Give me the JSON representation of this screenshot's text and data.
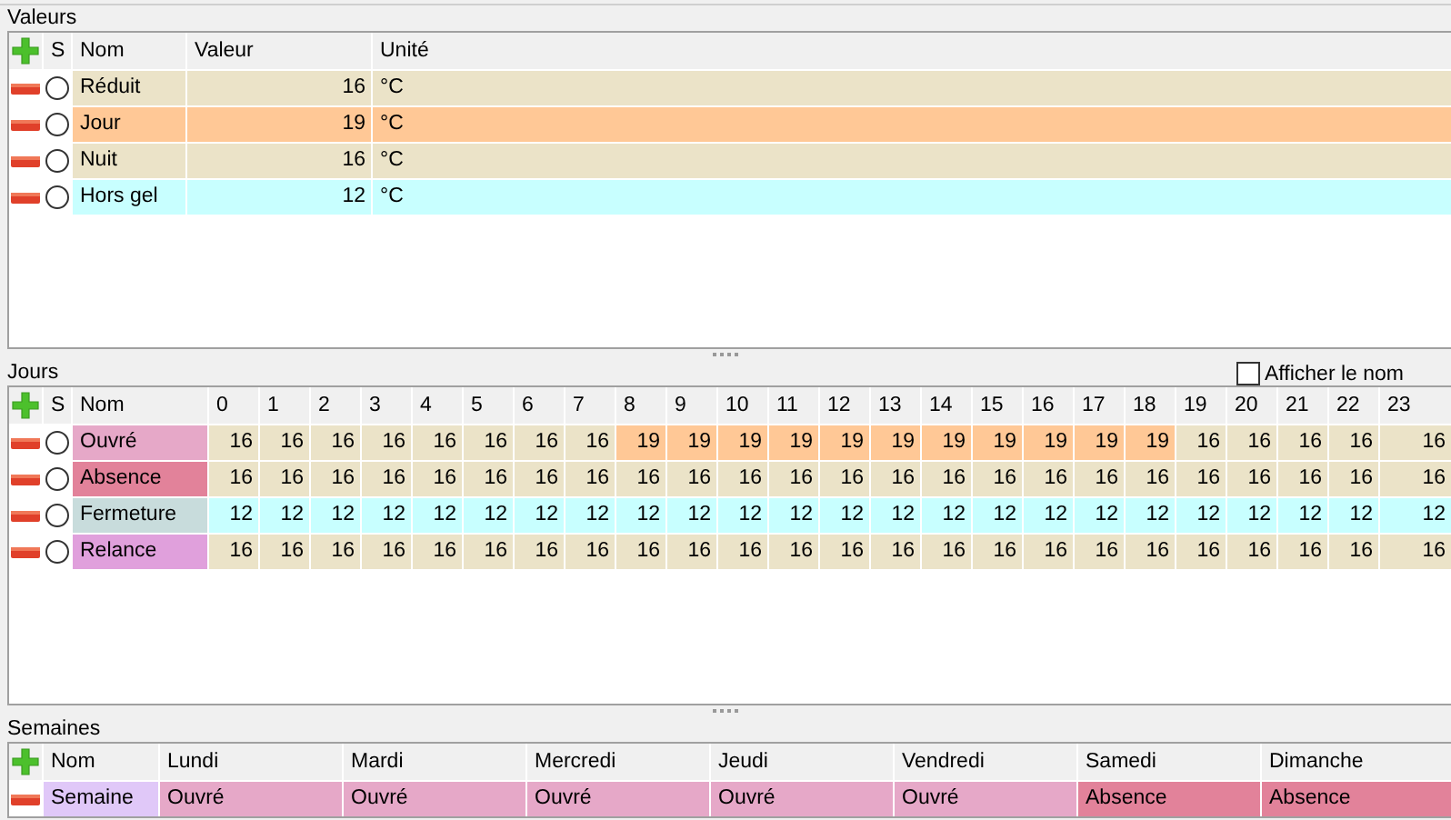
{
  "valeurs": {
    "title": "Valeurs",
    "columns": [
      "S",
      "Nom",
      "Valeur",
      "Unité"
    ],
    "rows": [
      {
        "selected": false,
        "name": "Réduit",
        "value": "16",
        "unit": "°C",
        "color": "#ebe3c8"
      },
      {
        "selected": false,
        "name": "Jour",
        "value": "19",
        "unit": "°C",
        "color": "#ffc896"
      },
      {
        "selected": false,
        "name": "Nuit",
        "value": "16",
        "unit": "°C",
        "color": "#ebe3c8"
      },
      {
        "selected": false,
        "name": "Hors gel",
        "value": "12",
        "unit": "°C",
        "color": "#c8ffff"
      }
    ]
  },
  "jours": {
    "title": "Jours",
    "show_name": {
      "label": "Afficher le nom",
      "checked": false
    },
    "columns": [
      "S",
      "Nom",
      "0",
      "1",
      "2",
      "3",
      "4",
      "5",
      "6",
      "7",
      "8",
      "9",
      "10",
      "11",
      "12",
      "13",
      "14",
      "15",
      "16",
      "17",
      "18",
      "19",
      "20",
      "21",
      "22",
      "23"
    ],
    "rows": [
      {
        "selected": false,
        "name": "Ouvré",
        "color": "#e6a8c8",
        "hours": [
          {
            "value": "16",
            "color": "#ebe3c8"
          },
          {
            "value": "16",
            "color": "#ebe3c8"
          },
          {
            "value": "16",
            "color": "#ebe3c8"
          },
          {
            "value": "16",
            "color": "#ebe3c8"
          },
          {
            "value": "16",
            "color": "#ebe3c8"
          },
          {
            "value": "16",
            "color": "#ebe3c8"
          },
          {
            "value": "16",
            "color": "#ebe3c8"
          },
          {
            "value": "16",
            "color": "#ebe3c8"
          },
          {
            "value": "19",
            "color": "#ffc896"
          },
          {
            "value": "19",
            "color": "#ffc896"
          },
          {
            "value": "19",
            "color": "#ffc896"
          },
          {
            "value": "19",
            "color": "#ffc896"
          },
          {
            "value": "19",
            "color": "#ffc896"
          },
          {
            "value": "19",
            "color": "#ffc896"
          },
          {
            "value": "19",
            "color": "#ffc896"
          },
          {
            "value": "19",
            "color": "#ffc896"
          },
          {
            "value": "19",
            "color": "#ffc896"
          },
          {
            "value": "19",
            "color": "#ffc896"
          },
          {
            "value": "19",
            "color": "#ffc896"
          },
          {
            "value": "16",
            "color": "#ebe3c8"
          },
          {
            "value": "16",
            "color": "#ebe3c8"
          },
          {
            "value": "16",
            "color": "#ebe3c8"
          },
          {
            "value": "16",
            "color": "#ebe3c8"
          },
          {
            "value": "16",
            "color": "#ebe3c8"
          }
        ]
      },
      {
        "selected": false,
        "name": "Absence",
        "color": "#e2829a",
        "hours": [
          {
            "value": "16",
            "color": "#ebe3c8"
          },
          {
            "value": "16",
            "color": "#ebe3c8"
          },
          {
            "value": "16",
            "color": "#ebe3c8"
          },
          {
            "value": "16",
            "color": "#ebe3c8"
          },
          {
            "value": "16",
            "color": "#ebe3c8"
          },
          {
            "value": "16",
            "color": "#ebe3c8"
          },
          {
            "value": "16",
            "color": "#ebe3c8"
          },
          {
            "value": "16",
            "color": "#ebe3c8"
          },
          {
            "value": "16",
            "color": "#ebe3c8"
          },
          {
            "value": "16",
            "color": "#ebe3c8"
          },
          {
            "value": "16",
            "color": "#ebe3c8"
          },
          {
            "value": "16",
            "color": "#ebe3c8"
          },
          {
            "value": "16",
            "color": "#ebe3c8"
          },
          {
            "value": "16",
            "color": "#ebe3c8"
          },
          {
            "value": "16",
            "color": "#ebe3c8"
          },
          {
            "value": "16",
            "color": "#ebe3c8"
          },
          {
            "value": "16",
            "color": "#ebe3c8"
          },
          {
            "value": "16",
            "color": "#ebe3c8"
          },
          {
            "value": "16",
            "color": "#ebe3c8"
          },
          {
            "value": "16",
            "color": "#ebe3c8"
          },
          {
            "value": "16",
            "color": "#ebe3c8"
          },
          {
            "value": "16",
            "color": "#ebe3c8"
          },
          {
            "value": "16",
            "color": "#ebe3c8"
          },
          {
            "value": "16",
            "color": "#ebe3c8"
          }
        ]
      },
      {
        "selected": false,
        "name": "Fermeture",
        "color": "#c8dcdc",
        "hours": [
          {
            "value": "12",
            "color": "#c8ffff"
          },
          {
            "value": "12",
            "color": "#c8ffff"
          },
          {
            "value": "12",
            "color": "#c8ffff"
          },
          {
            "value": "12",
            "color": "#c8ffff"
          },
          {
            "value": "12",
            "color": "#c8ffff"
          },
          {
            "value": "12",
            "color": "#c8ffff"
          },
          {
            "value": "12",
            "color": "#c8ffff"
          },
          {
            "value": "12",
            "color": "#c8ffff"
          },
          {
            "value": "12",
            "color": "#c8ffff"
          },
          {
            "value": "12",
            "color": "#c8ffff"
          },
          {
            "value": "12",
            "color": "#c8ffff"
          },
          {
            "value": "12",
            "color": "#c8ffff"
          },
          {
            "value": "12",
            "color": "#c8ffff"
          },
          {
            "value": "12",
            "color": "#c8ffff"
          },
          {
            "value": "12",
            "color": "#c8ffff"
          },
          {
            "value": "12",
            "color": "#c8ffff"
          },
          {
            "value": "12",
            "color": "#c8ffff"
          },
          {
            "value": "12",
            "color": "#c8ffff"
          },
          {
            "value": "12",
            "color": "#c8ffff"
          },
          {
            "value": "12",
            "color": "#c8ffff"
          },
          {
            "value": "12",
            "color": "#c8ffff"
          },
          {
            "value": "12",
            "color": "#c8ffff"
          },
          {
            "value": "12",
            "color": "#c8ffff"
          },
          {
            "value": "12",
            "color": "#c8ffff"
          }
        ]
      },
      {
        "selected": false,
        "name": "Relance",
        "color": "#e0a0dc",
        "hours": [
          {
            "value": "16",
            "color": "#ebe3c8"
          },
          {
            "value": "16",
            "color": "#ebe3c8"
          },
          {
            "value": "16",
            "color": "#ebe3c8"
          },
          {
            "value": "16",
            "color": "#ebe3c8"
          },
          {
            "value": "16",
            "color": "#ebe3c8"
          },
          {
            "value": "16",
            "color": "#ebe3c8"
          },
          {
            "value": "16",
            "color": "#ebe3c8"
          },
          {
            "value": "16",
            "color": "#ebe3c8"
          },
          {
            "value": "16",
            "color": "#ebe3c8"
          },
          {
            "value": "16",
            "color": "#ebe3c8"
          },
          {
            "value": "16",
            "color": "#ebe3c8"
          },
          {
            "value": "16",
            "color": "#ebe3c8"
          },
          {
            "value": "16",
            "color": "#ebe3c8"
          },
          {
            "value": "16",
            "color": "#ebe3c8"
          },
          {
            "value": "16",
            "color": "#ebe3c8"
          },
          {
            "value": "16",
            "color": "#ebe3c8"
          },
          {
            "value": "16",
            "color": "#ebe3c8"
          },
          {
            "value": "16",
            "color": "#ebe3c8"
          },
          {
            "value": "16",
            "color": "#ebe3c8"
          },
          {
            "value": "16",
            "color": "#ebe3c8"
          },
          {
            "value": "16",
            "color": "#ebe3c8"
          },
          {
            "value": "16",
            "color": "#ebe3c8"
          },
          {
            "value": "16",
            "color": "#ebe3c8"
          },
          {
            "value": "16",
            "color": "#ebe3c8"
          }
        ]
      }
    ]
  },
  "semaines": {
    "title": "Semaines",
    "columns": [
      "Nom",
      "Lundi",
      "Mardi",
      "Mercredi",
      "Jeudi",
      "Vendredi",
      "Samedi",
      "Dimanche"
    ],
    "rows": [
      {
        "name": "Semaine",
        "color": "#e0c8f8",
        "days": [
          {
            "value": "Ouvré",
            "color": "#e6a8c8"
          },
          {
            "value": "Ouvré",
            "color": "#e6a8c8"
          },
          {
            "value": "Ouvré",
            "color": "#e6a8c8"
          },
          {
            "value": "Ouvré",
            "color": "#e6a8c8"
          },
          {
            "value": "Ouvré",
            "color": "#e6a8c8"
          },
          {
            "value": "Absence",
            "color": "#e2829a"
          },
          {
            "value": "Absence",
            "color": "#e2829a"
          }
        ]
      }
    ]
  }
}
